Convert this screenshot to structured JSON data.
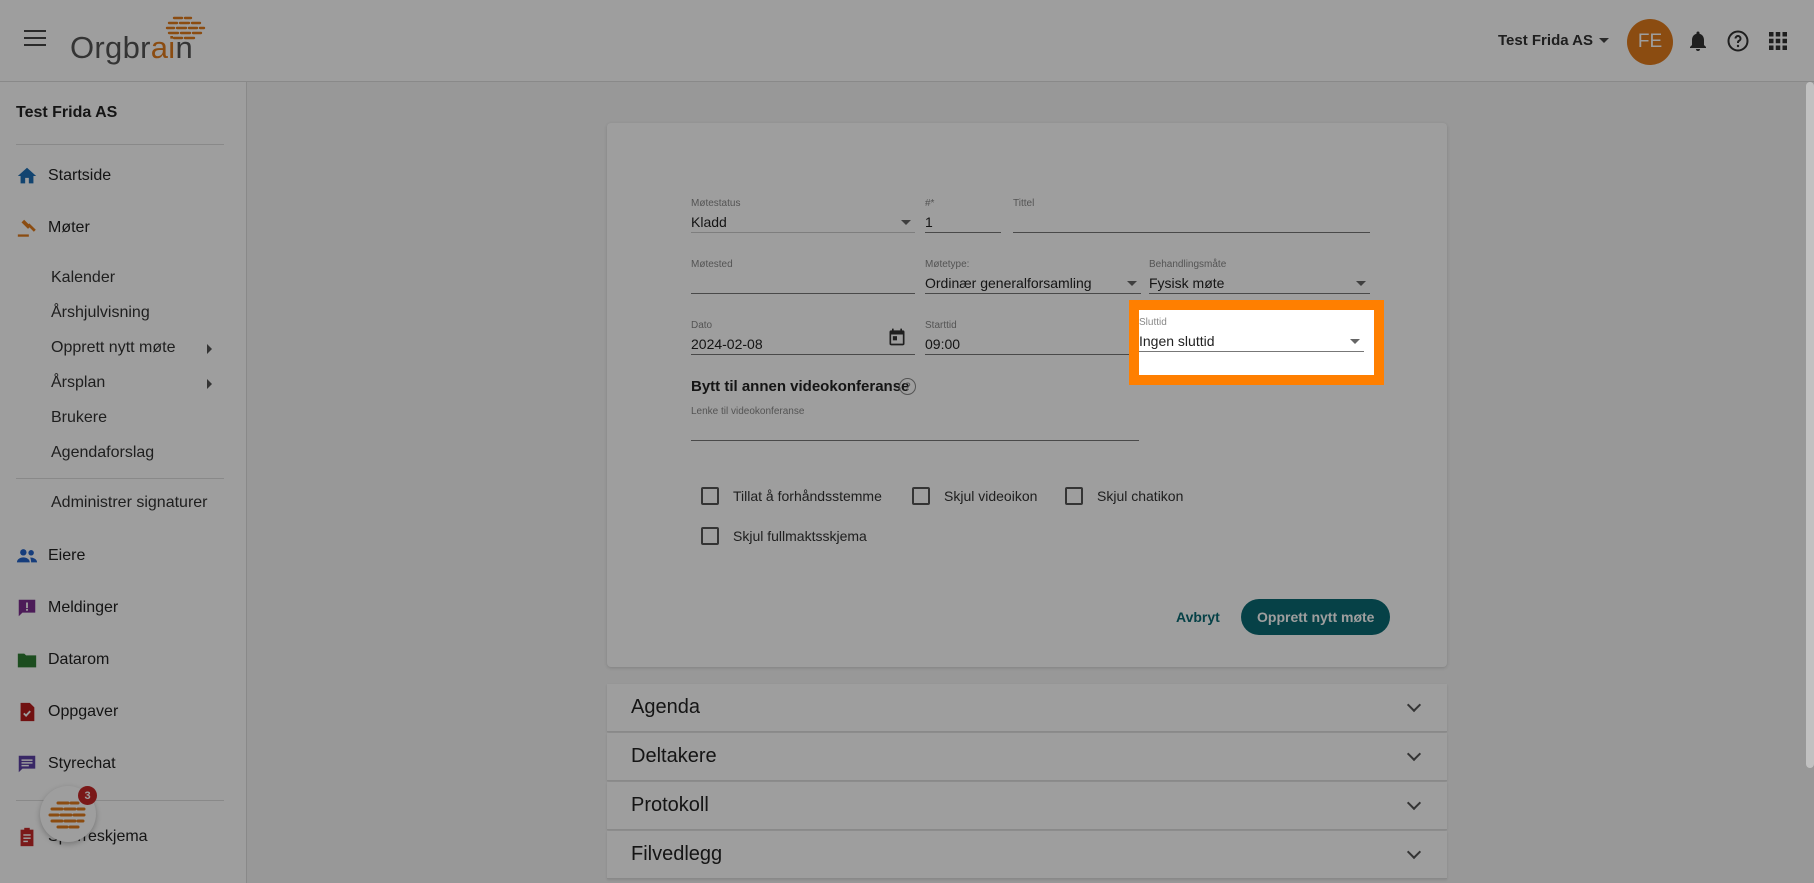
{
  "header": {
    "logo_text_pre": "Orgbr",
    "logo_text_accent": "ai",
    "logo_text_post": "n",
    "company": "Test Frida AS",
    "avatar_initials": "FE"
  },
  "sidebar": {
    "company": "Test Frida AS",
    "items": [
      {
        "label": "Startside",
        "icon": "home-icon",
        "color": "#1e6fb5"
      },
      {
        "label": "Møter",
        "icon": "gavel-icon",
        "color": "#e07b1c"
      },
      {
        "label": "Eiere",
        "icon": "people-icon",
        "color": "#2563c9"
      },
      {
        "label": "Meldinger",
        "icon": "message-alert-icon",
        "color": "#7b2d8e"
      },
      {
        "label": "Datarom",
        "icon": "folder-icon",
        "color": "#2e7d32"
      },
      {
        "label": "Oppgaver",
        "icon": "task-icon",
        "color": "#b71c1c"
      },
      {
        "label": "Styrechat",
        "icon": "chat-icon",
        "color": "#5b3fa3"
      },
      {
        "label": "Spørreskjema",
        "icon": "clipboard-icon",
        "color": "#c62828"
      }
    ],
    "sub_items": [
      "Kalender",
      "Årshjulvisning",
      "Opprett nytt møte",
      "Årsplan",
      "Brukere",
      "Agendaforslag",
      "Administrer signaturer"
    ],
    "chat_badge": "3"
  },
  "form": {
    "status_label": "Møtestatus",
    "status_value": "Kladd",
    "number_label": "#*",
    "number_value": "1",
    "title_label": "Tittel",
    "title_value": "",
    "location_label": "Møtested",
    "location_value": "",
    "type_label": "Møtetype:",
    "type_value": "Ordinær generalforsamling",
    "method_label": "Behandlingsmåte",
    "method_value": "Fysisk møte",
    "date_label": "Dato",
    "date_value": "2024-02-08",
    "start_label": "Starttid",
    "start_value": "09:00",
    "end_label": "Sluttid",
    "end_value": "Ingen sluttid",
    "video_heading": "Bytt til annen videokonferanse",
    "video_link_label": "Lenke til videokonferanse",
    "checkboxes": [
      "Tillat å forhåndsstemme",
      "Skjul videoikon",
      "Skjul chatikon",
      "Skjul fullmaktsskjema"
    ],
    "cancel": "Avbryt",
    "submit": "Opprett nytt møte"
  },
  "accordions": [
    "Agenda",
    "Deltakere",
    "Protokoll",
    "Filvedlegg"
  ],
  "colors": {
    "brand_orange": "#e07b1c",
    "primary_teal": "#0b6a73",
    "highlight": "#ff7f00"
  }
}
